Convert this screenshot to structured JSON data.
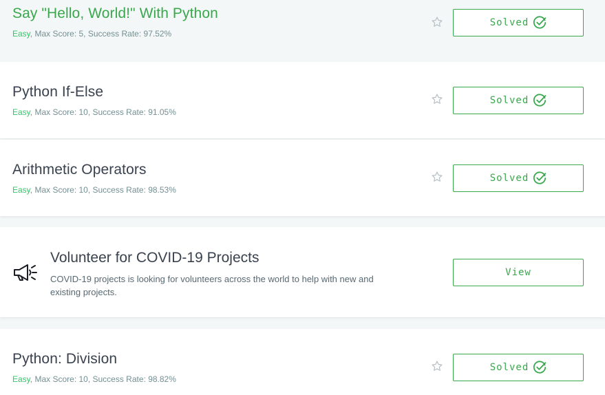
{
  "challenges": [
    {
      "title": "Say \"Hello, World!\" With Python",
      "difficulty": "Easy",
      "details": ", Max Score: 5, Success Rate: 97.52%",
      "button_label": "Solved",
      "state": "hovered"
    },
    {
      "title": "Python If-Else",
      "difficulty": "Easy",
      "details": ", Max Score: 10, Success Rate: 91.05%",
      "button_label": "Solved",
      "state": "normal"
    },
    {
      "title": "Arithmetic Operators",
      "difficulty": "Easy",
      "details": ", Max Score: 10, Success Rate: 98.53%",
      "button_label": "Solved",
      "state": "normal"
    },
    {
      "title": "Python: Division",
      "difficulty": "Easy",
      "details": ", Max Score: 10, Success Rate: 98.82%",
      "button_label": "Solved",
      "state": "normal"
    }
  ],
  "promo": {
    "title": "Volunteer for COVID-19 Projects",
    "description": "COVID-19 projects is looking for volunteers across the world to help with new and existing projects.",
    "button_label": "View",
    "icon": "megaphone-icon"
  },
  "colors": {
    "accent_green": "#39a84c",
    "difficulty_green": "#2ec866",
    "text_dark": "#39424e",
    "text_muted": "#738f93",
    "page_background": "#f3f7f7"
  }
}
